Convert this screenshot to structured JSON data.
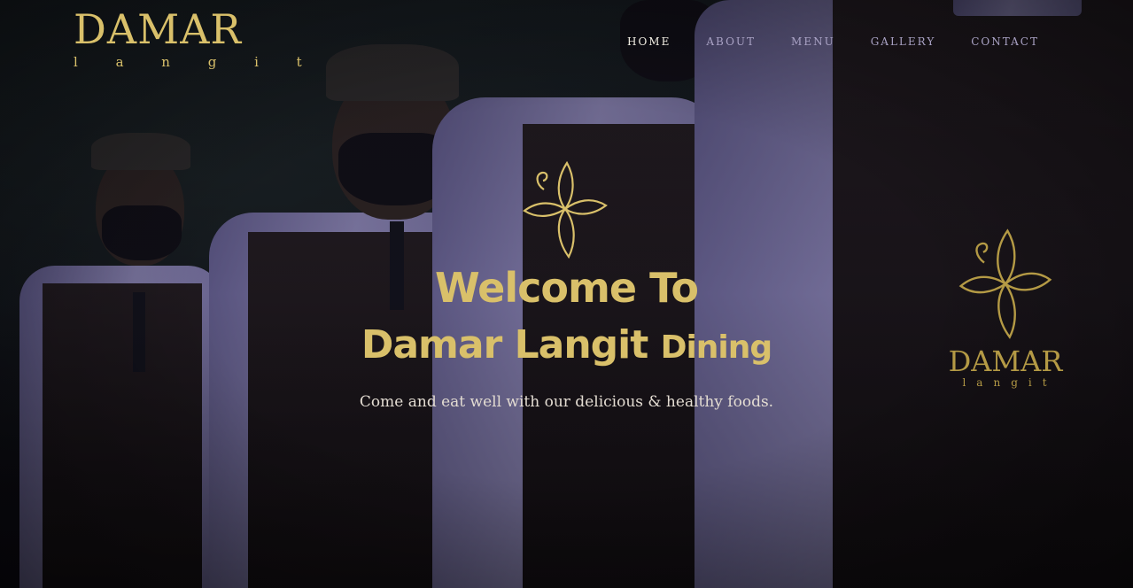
{
  "brand": {
    "name": "DAMAR",
    "sub": "l a n g i t"
  },
  "nav": {
    "items": [
      {
        "label": "HOME",
        "active": true
      },
      {
        "label": "ABOUT",
        "active": false
      },
      {
        "label": "MENU",
        "active": false
      },
      {
        "label": "GALLERY",
        "active": false
      },
      {
        "label": "CONTACT",
        "active": false
      }
    ]
  },
  "hero": {
    "title_line1": "Welcome To",
    "title_line2_main": "Damar Langit",
    "title_line2_small": "Dining",
    "tagline": "Come and eat well with our delicious & healthy foods."
  },
  "apron_logo": {
    "name": "DAMAR",
    "sub": "langit"
  },
  "colors": {
    "gold": "#d9c06a",
    "nav_text": "#a9a2c4",
    "nav_active": "#f2eee4",
    "tagline": "#e3dcd2"
  },
  "icons": {
    "emblem": "floral-cross-icon"
  }
}
